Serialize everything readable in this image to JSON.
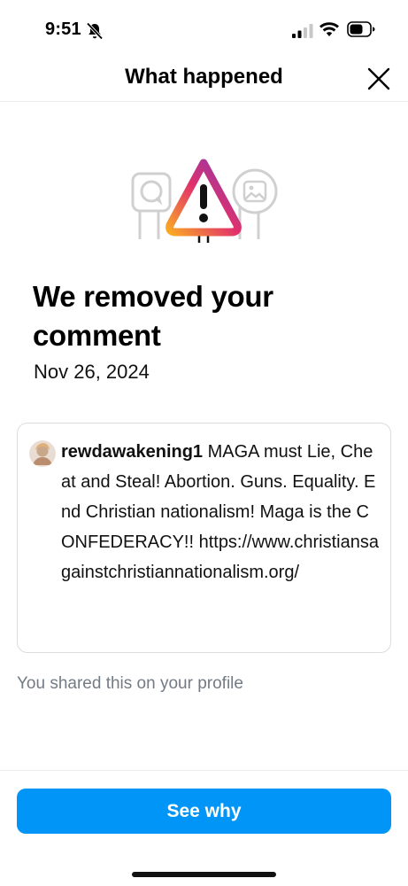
{
  "status_bar": {
    "time": "9:51",
    "icons": [
      "bell-slash-icon",
      "signal-icon",
      "wifi-icon",
      "battery-icon"
    ]
  },
  "header": {
    "title": "What happened",
    "close_icon": "close-icon"
  },
  "illustration": {
    "icons": [
      "warning-icon",
      "comment-bubble-icon",
      "image-icon"
    ],
    "gradient_colors": [
      "#f9a825",
      "#e1306c",
      "#833ab4"
    ]
  },
  "main": {
    "title": "We removed your comment",
    "date": "Nov 26, 2024"
  },
  "comment": {
    "username": "rewdawakening1",
    "text": " MAGA must Lie, Cheat and Steal! Abortion. Guns. Equality. End Christian nationalism! Maga is the CONFEDERACY!! https://​www.christiansagainstchristiannationalism.org/"
  },
  "shared_note": "You shared this on your profile",
  "footer": {
    "button_label": "See why",
    "button_color": "#0095f6"
  }
}
